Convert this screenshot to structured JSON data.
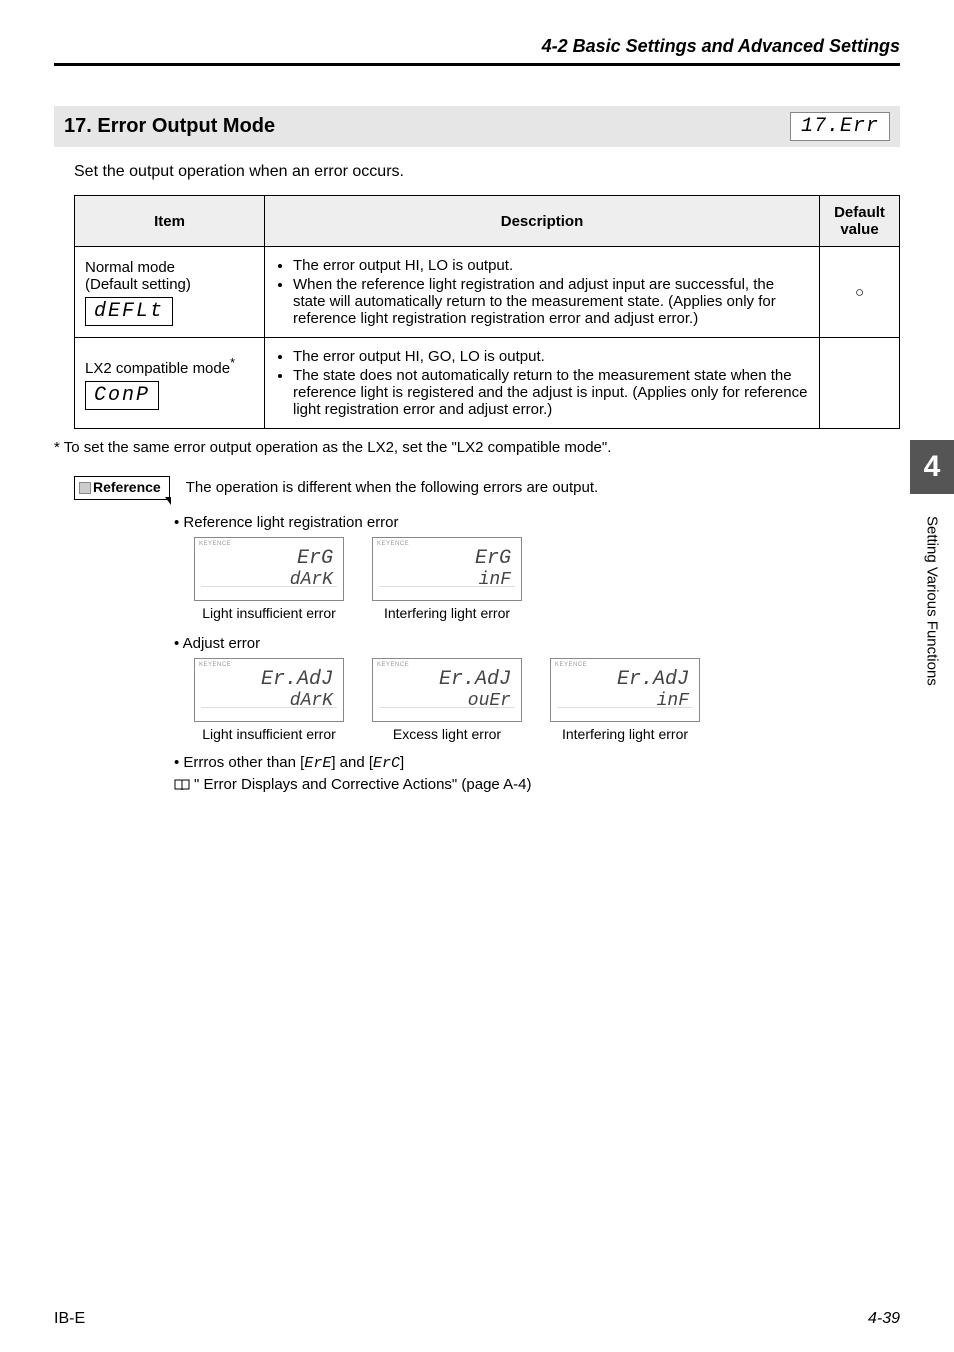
{
  "header": {
    "section_title": "4-2  Basic Settings and Advanced Settings"
  },
  "heading": {
    "number_title": "17. Error Output Mode",
    "display_code": "17.Err"
  },
  "intro": "Set the output operation when an error occurs.",
  "table": {
    "headers": {
      "item": "Item",
      "description": "Description",
      "default": "Default value"
    },
    "rows": [
      {
        "item_title": "Normal mode",
        "item_sub": "(Default setting)",
        "item_code": "dEFLt",
        "desc": [
          "The error output HI, LO is output.",
          "When the reference light registration and adjust input are successful, the state will automatically return to the measurement state. (Applies only for reference light registration registration error and adjust error.)"
        ],
        "default": "○"
      },
      {
        "item_title": "LX2 compatible mode",
        "item_sup": "*",
        "item_code": "ConP",
        "desc": [
          "The error output HI, GO, LO is output.",
          "The state does not automatically return to the measurement state when the reference light is registered and the adjust is input. (Applies only for reference light registration error and adjust error.)"
        ],
        "default": ""
      }
    ]
  },
  "footnote": "*    To set the same error output operation as the LX2, set the \"LX2 compatible mode\".",
  "reference": {
    "label": "Reference",
    "text": "The operation is different when the following errors are output."
  },
  "groups": [
    {
      "title": "•  Reference light registration error",
      "displays": [
        {
          "line1": "ErG",
          "line2": "dArK",
          "caption": "Light insufficient error"
        },
        {
          "line1": "ErG",
          "line2": "inF",
          "caption": "Interfering light error"
        }
      ]
    },
    {
      "title": "•  Adjust error",
      "displays": [
        {
          "line1": "Er.AdJ",
          "line2": "dArK",
          "caption": "Light insufficient error"
        },
        {
          "line1": "Er.AdJ",
          "line2": "ouEr",
          "caption": "Excess light error"
        },
        {
          "line1": "Er.AdJ",
          "line2": "inF",
          "caption": "Interfering light error"
        }
      ]
    }
  ],
  "other_errors": {
    "line1_prefix": "•  Errros other than [",
    "code1": "ErE",
    "mid": "] and [",
    "code2": "ErC",
    "suffix": "]",
    "link": "\" Error Displays and Corrective Actions\" (page A-4)"
  },
  "sidebar": {
    "chapter": "4",
    "label": "Setting Various Functions"
  },
  "footer": {
    "left": "IB-E",
    "right": "4-39"
  },
  "lcd_brand": "KEYENCE"
}
